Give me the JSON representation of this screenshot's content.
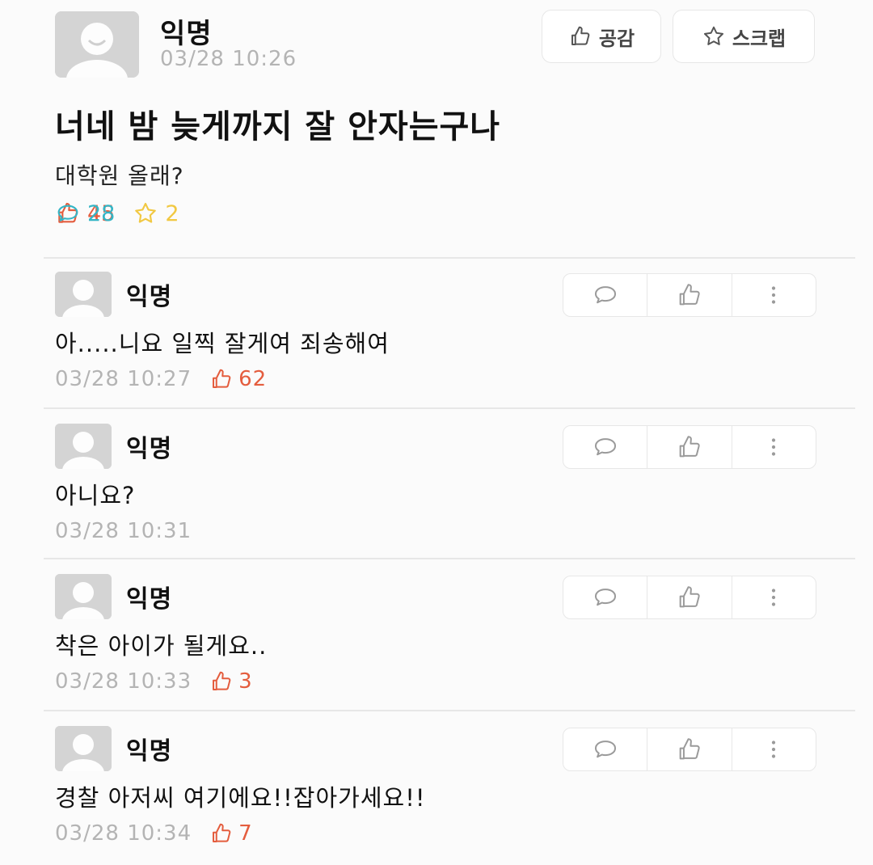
{
  "post": {
    "author": "익명",
    "time": "03/28 10:26",
    "like_button_label": "공감",
    "scrap_button_label": "스크랩",
    "title": "너네 밤 늦게까지 잘 안자는구나",
    "body": "대학원 올래?",
    "stats": {
      "likes": "45",
      "comments": "28",
      "scraps": "2"
    }
  },
  "comments": [
    {
      "author": "익명",
      "text": "아.....니요 일찍 잘게여 죄송해여",
      "time": "03/28 10:27",
      "likes": "62"
    },
    {
      "author": "익명",
      "text": "아니요?",
      "time": "03/28 10:31",
      "likes": ""
    },
    {
      "author": "익명",
      "text": "착은 아이가 될게요..",
      "time": "03/28 10:33",
      "likes": "3"
    },
    {
      "author": "익명",
      "text": "경찰 아저씨 여기에요!!잡아가세요!!",
      "time": "03/28 10:34",
      "likes": "7"
    }
  ],
  "colors": {
    "like": "#e45d3e",
    "comment": "#34b5c5",
    "scrap": "#f1c842",
    "muted": "#b4b4b4"
  },
  "icons": [
    "avatar-placeholder-icon",
    "thumbs-up-icon",
    "star-icon",
    "speech-bubble-icon",
    "more-vertical-icon"
  ]
}
